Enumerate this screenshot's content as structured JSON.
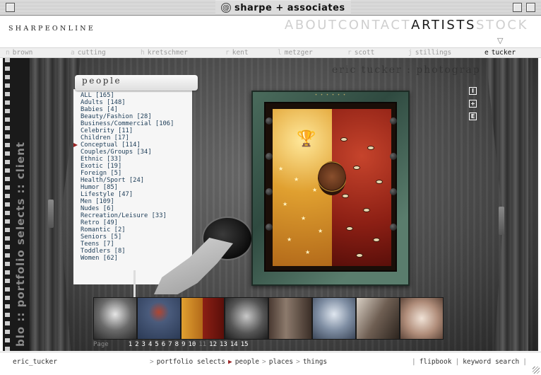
{
  "window": {
    "title": "sharpe + associates"
  },
  "header": {
    "logo": "SHARPEONLINE",
    "nav": [
      {
        "label": "ABOUT",
        "active": false
      },
      {
        "label": "CONTACT",
        "active": false
      },
      {
        "label": "ARTISTS",
        "active": true
      },
      {
        "label": "STOCK",
        "active": false
      }
    ],
    "dropdown_arrow": "▽"
  },
  "artists": [
    {
      "initial": "n",
      "name": "brown",
      "active": false
    },
    {
      "initial": "a",
      "name": "cutting",
      "active": false
    },
    {
      "initial": "h",
      "name": "kretschmer",
      "active": false
    },
    {
      "initial": "r",
      "name": "kent",
      "active": false
    },
    {
      "initial": "l",
      "name": "metzger",
      "active": false
    },
    {
      "initial": "r",
      "name": "scott",
      "active": false
    },
    {
      "initial": "j",
      "name": "stillings",
      "active": false
    },
    {
      "initial": "e",
      "name": "tucker",
      "active": true
    }
  ],
  "stage": {
    "side_banner": "blo :: portfolio selects :: client",
    "photographer_banner": "eric tucker : photograp",
    "scroll_heading": "people",
    "categories": [
      {
        "label": "ALL [165]",
        "selected": false
      },
      {
        "label": "Adults [148]",
        "selected": false
      },
      {
        "label": "Babies [4]",
        "selected": false
      },
      {
        "label": "Beauty/Fashion [28]",
        "selected": false
      },
      {
        "label": "Business/Commercial [106]",
        "selected": false
      },
      {
        "label": "Celebrity [11]",
        "selected": false
      },
      {
        "label": "Children [17]",
        "selected": false
      },
      {
        "label": "Conceptual [114]",
        "selected": true
      },
      {
        "label": "Couples/Groups [34]",
        "selected": false
      },
      {
        "label": "Ethnic [33]",
        "selected": false
      },
      {
        "label": "Exotic [19]",
        "selected": false
      },
      {
        "label": "Foreign [5]",
        "selected": false
      },
      {
        "label": "Health/Sport [24]",
        "selected": false
      },
      {
        "label": "Humor [85]",
        "selected": false
      },
      {
        "label": "Lifestyle [47]",
        "selected": false
      },
      {
        "label": "Men [109]",
        "selected": false
      },
      {
        "label": "Nudes [6]",
        "selected": false
      },
      {
        "label": "Recreation/Leisure [33]",
        "selected": false
      },
      {
        "label": "Retro [49]",
        "selected": false
      },
      {
        "label": "Romantic [2]",
        "selected": false
      },
      {
        "label": "Seniors [5]",
        "selected": false
      },
      {
        "label": "Teens [7]",
        "selected": false
      },
      {
        "label": "Toddlers [8]",
        "selected": false
      },
      {
        "label": "Women [62]",
        "selected": false
      }
    ],
    "side_icons": [
      {
        "icon": "info-icon",
        "glyph": "I"
      },
      {
        "icon": "plus-icon",
        "glyph": "+"
      },
      {
        "icon": "email-icon",
        "glyph": "E"
      }
    ],
    "pager": {
      "label": "Page",
      "pages": [
        "1",
        "2",
        "3",
        "4",
        "5",
        "6",
        "7",
        "8",
        "9",
        "10",
        "11",
        "12",
        "13",
        "14",
        "15"
      ],
      "dim_pages": [
        "11"
      ]
    }
  },
  "footer": {
    "user": "eric_tucker",
    "crumbs": [
      {
        "label": "portfolio selects",
        "current": false
      },
      {
        "label": "people",
        "current": true
      },
      {
        "label": "places",
        "current": false
      },
      {
        "label": "things",
        "current": false
      }
    ],
    "links": [
      "flipbook",
      "keyword search"
    ]
  },
  "colors": {
    "category_text": "#1b3b56",
    "selected_marker": "#9b2424",
    "nav_inactive": "#cfcfcf",
    "nav_active": "#1a1a1a"
  }
}
